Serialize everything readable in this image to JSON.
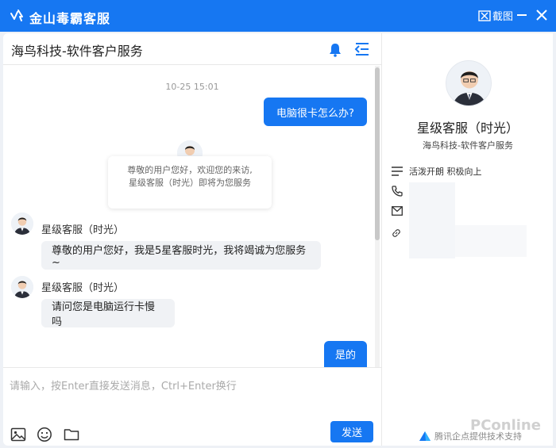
{
  "window": {
    "title": "金山毒霸客服",
    "screenshot_label": "截图",
    "accent_color": "#1677f2"
  },
  "chat": {
    "title": "海鸟科技-软件客户服务",
    "timestamp": "10-25 15:01",
    "messages": {
      "user_1": "电脑很卡怎么办?",
      "welcome_line_1": "尊敬的用户您好，欢迎您的来访,",
      "welcome_line_2": "星级客服（时光）即将为您服务",
      "agent_name_1": "星级客服（时光）",
      "agent_msg_1": "尊敬的用户您好，我是5星客服时光，我将竭诚为您服务~",
      "agent_name_2": "星级客服（时光）",
      "agent_msg_2": "请问您是电脑运行卡慢吗",
      "user_2": "是的"
    },
    "input_placeholder": "请输入，按Enter直接发送消息，Ctrl+Enter换行",
    "send_label": "发送"
  },
  "agent_panel": {
    "name": "星级客服（时光）",
    "company": "海鸟科技-软件客户服务",
    "motto": "活泼开朗 积极向上",
    "footer": "腾讯企点提供技术支持"
  },
  "watermark": "PConline",
  "icons": [
    "app-logo-icon",
    "scissors-icon",
    "minimize-icon",
    "close-icon",
    "bell-icon",
    "menu-collapse-icon",
    "image-icon",
    "emoji-icon",
    "folder-icon",
    "list-icon",
    "phone-icon",
    "mail-icon",
    "link-icon"
  ]
}
